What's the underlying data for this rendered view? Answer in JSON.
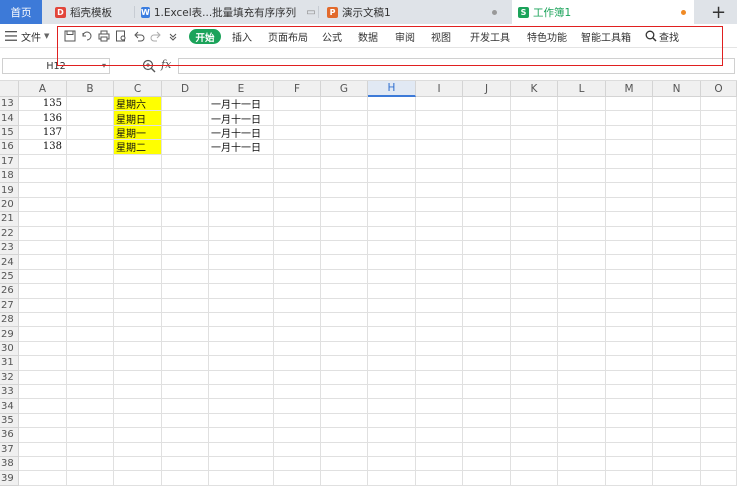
{
  "tabs": [
    {
      "label": "首页",
      "kind": "home"
    },
    {
      "label": "稻壳模板",
      "kind": "docer",
      "icon_color": "#e2463b"
    },
    {
      "label": "1.Excel表...批量填充有序序列",
      "kind": "doc",
      "icon_color": "#3b7de0",
      "icon_letter": "W"
    },
    {
      "label": "演示文稿1",
      "kind": "ppt",
      "icon_color": "#e26a2c",
      "icon_letter": "P"
    },
    {
      "label": "工作簿1",
      "kind": "sheet",
      "icon_color": "#1ba35a",
      "icon_letter": "S",
      "active": true
    }
  ],
  "new_tab_label": "+",
  "menubar": {
    "file_label": "文件",
    "start_label": "开始",
    "items": [
      "插入",
      "页面布局",
      "公式",
      "数据",
      "审阅",
      "视图",
      "开发工具",
      "特色功能",
      "智能工具箱"
    ],
    "search_label": "查找"
  },
  "formula_bar": {
    "cell_ref": "H12",
    "fx_label": "fx",
    "formula_value": ""
  },
  "grid": {
    "columns": [
      "A",
      "B",
      "C",
      "D",
      "E",
      "F",
      "G",
      "H",
      "I",
      "J",
      "K",
      "L",
      "M",
      "N",
      "O"
    ],
    "selected_column": "H",
    "row_numbers": [
      "13",
      "14",
      "15",
      "16",
      "17",
      "18",
      "19",
      "20",
      "21",
      "22",
      "23",
      "24",
      "25",
      "26",
      "27",
      "28",
      "29",
      "30",
      "31",
      "32",
      "33",
      "34",
      "35",
      "36",
      "37",
      "38",
      "39"
    ],
    "data_rows": [
      {
        "A": "135",
        "C": "星期六",
        "E": "一月十一日"
      },
      {
        "A": "136",
        "C": "星期日",
        "E": "一月十一日"
      },
      {
        "A": "137",
        "C": "星期一",
        "E": "一月十一日"
      },
      {
        "A": "138",
        "C": "星期二",
        "E": "一月十一日"
      }
    ],
    "highlight_color": "#ffff00"
  },
  "colors": {
    "home_tab": "#3d7ad8",
    "start_button": "#1ba35a",
    "annotation_box": "#e02020"
  }
}
